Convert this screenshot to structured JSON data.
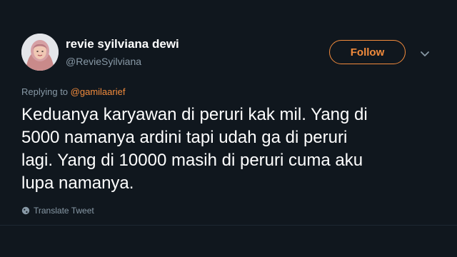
{
  "user": {
    "display_name": "revie syilviana dewi",
    "handle": "@ReviеSyilviana"
  },
  "follow_button": {
    "label": "Follow"
  },
  "reply": {
    "prefix": "Replying to",
    "mention": "@gamilaarief"
  },
  "tweet": {
    "lines": [
      "Keduanya karyawan di peruri kak mil. Yang di",
      "5000 namanya ardini tapi udah ga di peruri",
      "lagi. Yang di 10000 masih di peruri cuma aku",
      "lupa namanya."
    ]
  },
  "translate": {
    "label": "Translate Tweet"
  },
  "icons": {
    "more": "chevron-down-icon",
    "translate": "globe-icon"
  },
  "colors": {
    "background": "#10171e",
    "accent": "#f28b3c",
    "secondary_text": "#8899a6",
    "primary_text": "#ffffff"
  }
}
